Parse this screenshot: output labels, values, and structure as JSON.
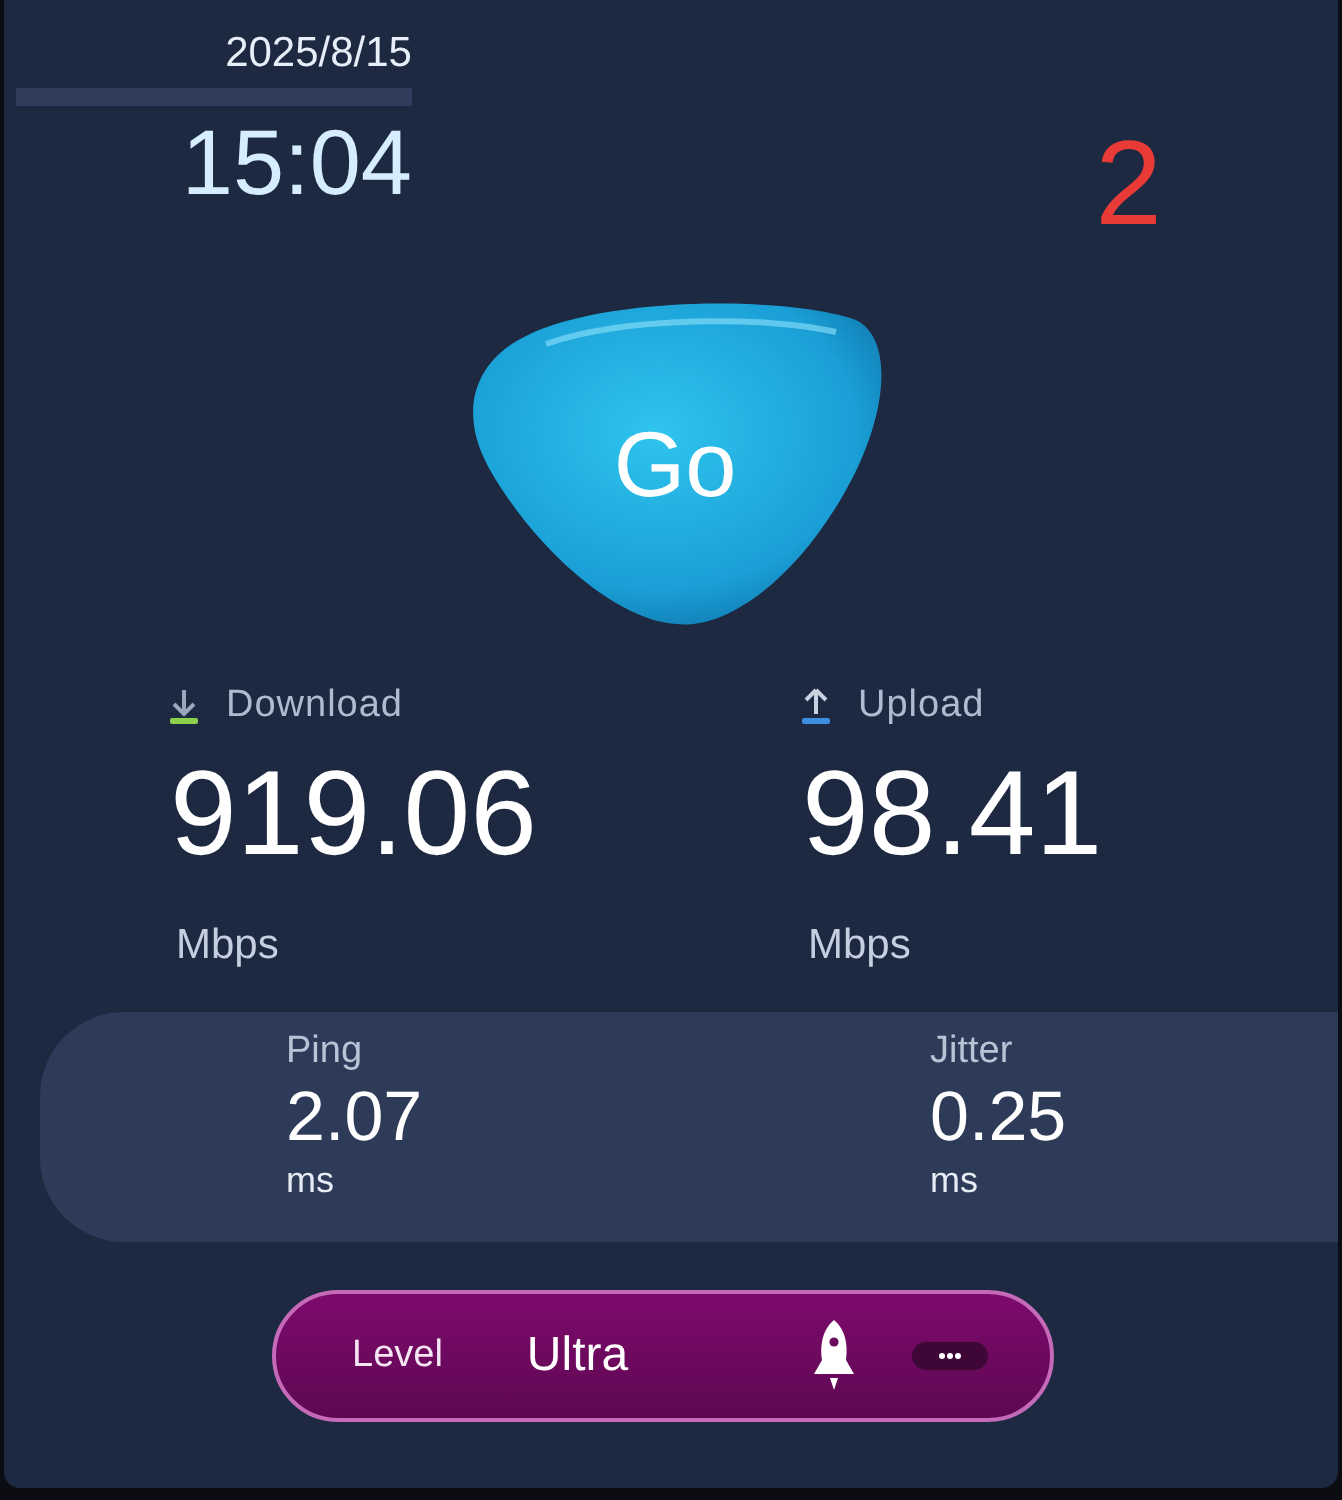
{
  "header": {
    "date": "2025/8/15",
    "time": "15:04",
    "badge": "2"
  },
  "go_button": {
    "label": "Go"
  },
  "metrics": [
    {
      "kind": "download",
      "label": "Download",
      "value": "919.06",
      "unit": "Mbps"
    },
    {
      "kind": "upload",
      "label": "Upload",
      "value": "98.41",
      "unit": "Mbps"
    }
  ],
  "latency": [
    {
      "label": "Ping",
      "value": "2.07",
      "unit": "ms"
    },
    {
      "label": "Jitter",
      "value": "0.25",
      "unit": "ms"
    }
  ],
  "level": {
    "label": "Level",
    "value": "Ultra"
  }
}
